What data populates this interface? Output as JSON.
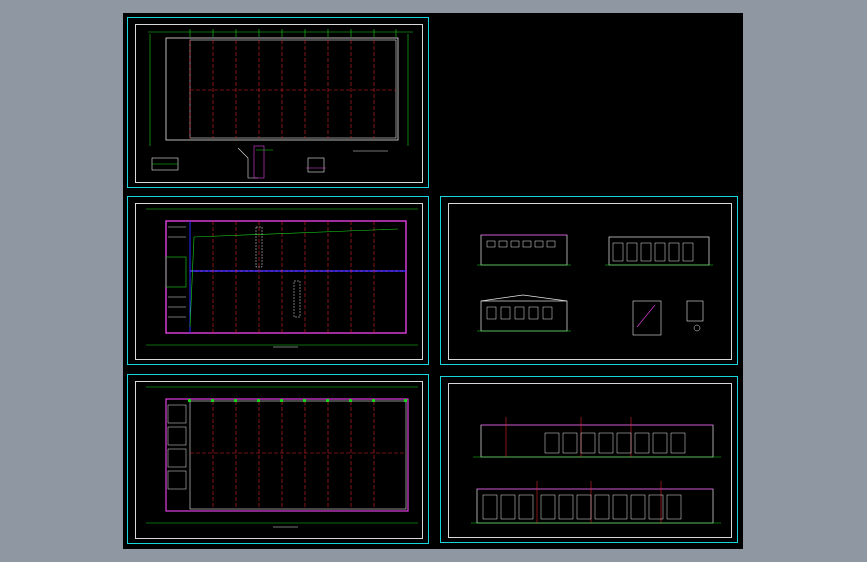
{
  "colors": {
    "background": "#8e97a2",
    "canvas": "#000000",
    "sheet_border": "#19d4dc",
    "inner_border": "#d8d8d8",
    "grid_red": "#e0222a",
    "dim_green": "#19d419",
    "wall_magenta": "#e040e0",
    "wall_blue": "#2a2aff",
    "outline_white": "#e8e8e8"
  },
  "sheets": [
    {
      "id": "roof-plan",
      "title": ""
    },
    {
      "id": "floor-plan-2",
      "title": ""
    },
    {
      "id": "floor-plan-1",
      "title": ""
    },
    {
      "id": "sections",
      "title": ""
    },
    {
      "id": "elevations",
      "title": ""
    }
  ]
}
